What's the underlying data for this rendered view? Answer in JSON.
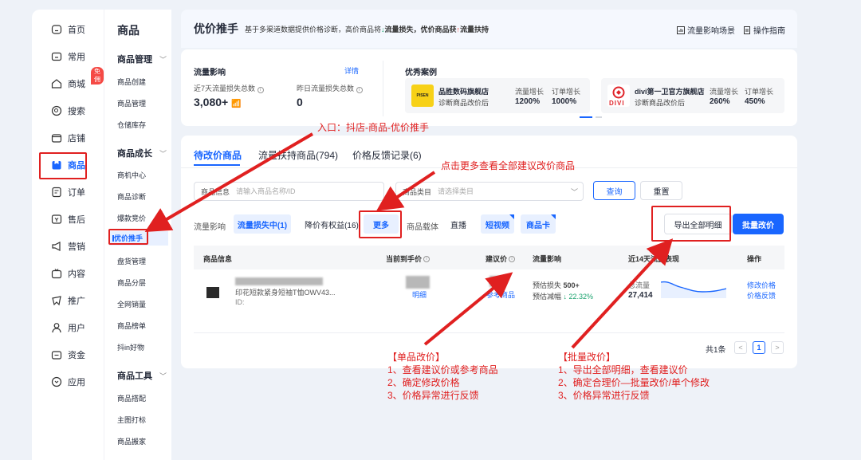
{
  "nav": {
    "items": [
      {
        "label": "首页",
        "icon": "home-icon"
      },
      {
        "label": "常用",
        "icon": "folder-icon"
      },
      {
        "label": "商城",
        "icon": "store-icon",
        "badge": "免佣"
      },
      {
        "label": "搜索",
        "icon": "search-icon"
      },
      {
        "label": "店铺",
        "icon": "shop-icon"
      },
      {
        "label": "商品",
        "icon": "goods-icon",
        "active": true
      },
      {
        "label": "订单",
        "icon": "order-icon"
      },
      {
        "label": "售后",
        "icon": "aftersale-icon"
      },
      {
        "label": "营销",
        "icon": "megaphone-icon"
      },
      {
        "label": "内容",
        "icon": "tv-icon"
      },
      {
        "label": "推广",
        "icon": "promote-icon"
      },
      {
        "label": "用户",
        "icon": "user-icon"
      },
      {
        "label": "资金",
        "icon": "wallet-icon"
      },
      {
        "label": "应用",
        "icon": "app-icon"
      }
    ]
  },
  "submenu": {
    "title": "商品",
    "groups": [
      {
        "label": "商品管理",
        "items": [
          "商品创建",
          "商品管理",
          "仓储库存"
        ]
      },
      {
        "label": "商品成长",
        "items": [
          "商机中心",
          "商品诊断",
          "爆款竞价",
          "优价推手",
          "盘货管理",
          "商品分层",
          "全网销量",
          "商品榜单",
          "抖in好物"
        ]
      },
      {
        "label": "商品工具",
        "items": [
          "商品搭配",
          "主图打标",
          "商品搬家"
        ]
      }
    ]
  },
  "header": {
    "title": "优价推手",
    "desc_1": "基于多渠道数据提供价格诊断，高价商品将",
    "desc_down": "↓",
    "desc_2": "流量损失，优价商品获",
    "desc_up": "↑",
    "desc_3": "流量扶持",
    "link_scene": "流量影响场景",
    "link_guide": "操作指南"
  },
  "traffic": {
    "title": "流量影响",
    "detail_link": "详情",
    "loss7_label": "近7天流量损失总数",
    "loss7_value": "3,080+",
    "lossy_label": "昨日流量损失总数",
    "lossy_value": "0"
  },
  "cases": {
    "title": "优秀案例",
    "items": [
      {
        "shop": "品胜数码旗舰店",
        "sub": "诊断商品改价后",
        "l1": "流量增长",
        "v1": "1200%",
        "l2": "订单增长",
        "v2": "1000%",
        "logo_text": "PISEN",
        "color": "#f7d117"
      },
      {
        "shop": "divi第一卫官方旗舰店",
        "sub": "诊断商品改价后",
        "l1": "流量增长",
        "v1": "260%",
        "l2": "订单增长",
        "v2": "450%",
        "logo_text": "DIVI",
        "color": "#e0242a"
      }
    ]
  },
  "tabs": [
    {
      "label": "待改价商品",
      "active": true
    },
    {
      "label": "流量扶持商品(794)"
    },
    {
      "label": "价格反馈记录(6)"
    }
  ],
  "filters": {
    "product_label": "商品信息",
    "product_placeholder": "请输入商品名称/ID",
    "category_label": "商品类目",
    "category_placeholder": "请选择类目",
    "query_btn": "查询",
    "reset_btn": "重置",
    "traffic_label": "流量影响",
    "chip_loss": "流量损失中(1)",
    "chip_rights": "降价有权益(16)",
    "chip_more": "更多",
    "carrier_label": "商品载体",
    "chip_live": "直播",
    "chip_video": "短视频",
    "chip_card": "商品卡",
    "export_btn": "导出全部明细",
    "batch_btn": "批量改价"
  },
  "table": {
    "headers": [
      "商品信息",
      "当前到手价",
      "建议价",
      "流量影响",
      "近14天流量表现",
      "操作"
    ],
    "row": {
      "title_fragment": "印花短款紧身短袖T恤OWV43...",
      "id_label": "ID:",
      "price_link": "明细",
      "suggest_link": "参考商品",
      "impact_l1": "预估损失",
      "impact_v1": "500+",
      "impact_l2": "预估减幅",
      "impact_v2": "↓ 22.32%",
      "total_label": "总流量",
      "total_value": "27,414",
      "op1": "修改价格",
      "op2": "价格反馈"
    }
  },
  "pagination": {
    "total": "共1条",
    "prev": "<",
    "page": "1",
    "next": ">"
  },
  "annotations": {
    "entry": "入口：抖店-商品-优价推手",
    "more": "点击更多查看全部建议改价商品",
    "single_title": "【单品改价】",
    "single_1": "1、查看建议价或参考商品",
    "single_2": "2、确定修改价格",
    "single_3": "3、价格异常进行反馈",
    "batch_title": "【批量改价】",
    "batch_1": "1、导出全部明细，查看建议价",
    "batch_2": "2、确定合理价—批量改价/单个修改",
    "batch_3": "3、价格异常进行反馈"
  },
  "colors": {
    "brand": "#1966ff",
    "annot": "#e02020"
  }
}
